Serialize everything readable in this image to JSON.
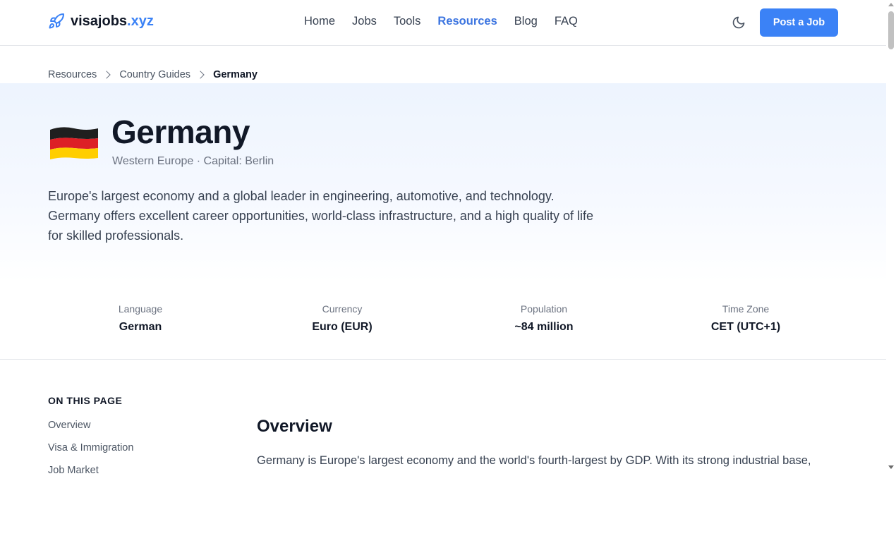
{
  "header": {
    "brand": "visajobs",
    "tld": ".xyz",
    "logo_icon": "rocket-icon",
    "nav": [
      {
        "label": "Home",
        "active": false
      },
      {
        "label": "Jobs",
        "active": false
      },
      {
        "label": "Tools",
        "active": false
      },
      {
        "label": "Resources",
        "active": true
      },
      {
        "label": "Blog",
        "active": false
      },
      {
        "label": "FAQ",
        "active": false
      }
    ],
    "theme_icon": "moon-icon",
    "post_button": "Post a Job"
  },
  "breadcrumb": [
    "Resources",
    "Country Guides",
    "Germany"
  ],
  "country": {
    "flag_icon": "germany-flag-icon",
    "name": "Germany",
    "subtitle": "Western Europe · Capital: Berlin",
    "description": "Europe's largest economy and a global leader in engineering, automotive, and technology. Germany offers excellent career opportunities, world-class infrastructure, and a high quality of life for skilled professionals."
  },
  "stats": [
    {
      "label": "Language",
      "value": "German"
    },
    {
      "label": "Currency",
      "value": "Euro (EUR)"
    },
    {
      "label": "Population",
      "value": "~84 million"
    },
    {
      "label": "Time Zone",
      "value": "CET (UTC+1)"
    }
  ],
  "toc": {
    "title": "ON THIS PAGE",
    "items": [
      "Overview",
      "Visa & Immigration",
      "Job Market"
    ]
  },
  "section": {
    "title": "Overview",
    "text": "Germany is Europe's largest economy and the world's fourth-largest by GDP. With its strong industrial base,"
  },
  "colors": {
    "accent": "#3b82f6",
    "nav_active": "#3b74e0",
    "hero_bg": "#edf4fe"
  }
}
